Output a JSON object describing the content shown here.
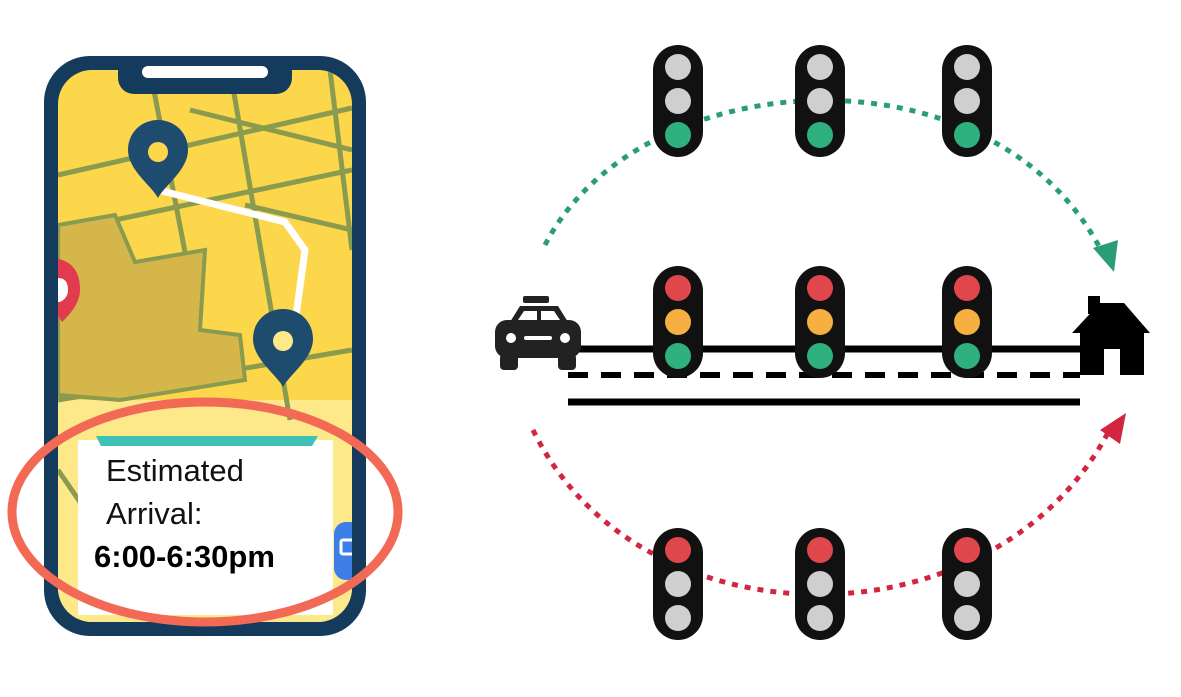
{
  "colors": {
    "background": "#ffffff",
    "phone_frame": "#143a5c",
    "map_yellow": "#fcd64b",
    "map_yellow_light": "#fde88a",
    "map_road": "#8a9a4e",
    "map_park": "#d4b64a",
    "route": "#ffffff",
    "pin": "#1d4c6e",
    "card_accent": "#3fc1b5",
    "highlight_ellipse": "#f26a55",
    "light_red": "#e0474c",
    "light_amber": "#f5b041",
    "light_green": "#2fb07f",
    "light_off": "#cfcfcf",
    "light_housing": "#111111",
    "arrow_green": "#2a9d78",
    "arrow_red": "#d2253f",
    "road": "#000000"
  },
  "phone": {
    "eta_label_line1": "Estimated",
    "eta_label_line2": "Arrival:",
    "eta_value": "6:00-6:30pm",
    "icons": [
      "location-pin-icon",
      "location-pin-icon",
      "map-marker-icon",
      "app-badge-icon"
    ]
  },
  "diagram": {
    "origin_icon": "taxi-icon",
    "destination_icon": "house-icon",
    "top_route": {
      "lights": [
        "green",
        "green",
        "green"
      ],
      "arrow_color": "green"
    },
    "middle_route": {
      "lights": [
        "red-amber-green",
        "red-amber-green",
        "red-amber-green"
      ]
    },
    "bottom_route": {
      "lights": [
        "red",
        "red",
        "red"
      ],
      "arrow_color": "red"
    }
  }
}
